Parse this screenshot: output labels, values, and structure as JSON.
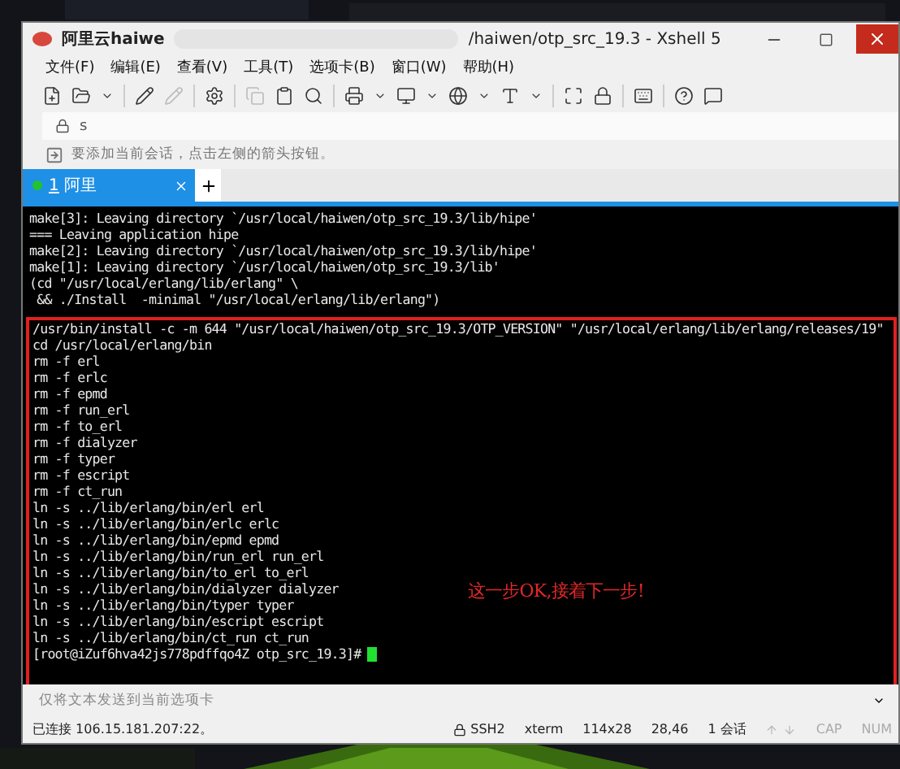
{
  "window": {
    "title_prefix": "阿里云haiwe",
    "title_suffix": "/haiwen/otp_src_19.3 - Xshell 5"
  },
  "menu": [
    "文件(F)",
    "编辑(E)",
    "查看(V)",
    "工具(T)",
    "选项卡(B)",
    "窗口(W)",
    "帮助(H)"
  ],
  "address": {
    "value": "s"
  },
  "hint": "要添加当前会话，点击左侧的箭头按钮。",
  "tabs": [
    {
      "number": "1",
      "label": "阿里",
      "selected": true,
      "connected": true
    }
  ],
  "terminal": {
    "lines": [
      "make[3]: Leaving directory `/usr/local/haiwen/otp_src_19.3/lib/hipe'",
      "=== Leaving application hipe",
      "make[2]: Leaving directory `/usr/local/haiwen/otp_src_19.3/lib/hipe'",
      "make[1]: Leaving directory `/usr/local/haiwen/otp_src_19.3/lib'",
      "(cd \"/usr/local/erlang/lib/erlang\" \\",
      " && ./Install  -minimal \"/usr/local/erlang/lib/erlang\")"
    ],
    "highlighted_lines": [
      "/usr/bin/install -c -m 644 \"/usr/local/haiwen/otp_src_19.3/OTP_VERSION\" \"/usr/local/erlang/lib/erlang/releases/19\"",
      "cd /usr/local/erlang/bin",
      "rm -f erl",
      "rm -f erlc",
      "rm -f epmd",
      "rm -f run_erl",
      "rm -f to_erl",
      "rm -f dialyzer",
      "rm -f typer",
      "rm -f escript",
      "rm -f ct_run",
      "ln -s ../lib/erlang/bin/erl erl",
      "ln -s ../lib/erlang/bin/erlc erlc",
      "ln -s ../lib/erlang/bin/epmd epmd",
      "ln -s ../lib/erlang/bin/run_erl run_erl",
      "ln -s ../lib/erlang/bin/to_erl to_erl",
      "ln -s ../lib/erlang/bin/dialyzer dialyzer",
      "ln -s ../lib/erlang/bin/typer typer",
      "ln -s ../lib/erlang/bin/escript escript",
      "ln -s ../lib/erlang/bin/ct_run ct_run"
    ],
    "prompt": "[root@iZuf6hva42js778pdffqo4Z otp_src_19.3]#",
    "annotation": "这一步OK,接着下一步!"
  },
  "send_bar": {
    "placeholder": "仅将文本发送到当前选项卡"
  },
  "status_bar": {
    "connection": "已连接 106.15.181.207:22。",
    "protocol": "SSH2",
    "terminal_type": "xterm",
    "size": "114x28",
    "cursor": "28,46",
    "sessions": "1 会话",
    "caps": "CAP",
    "num": "NUM"
  }
}
